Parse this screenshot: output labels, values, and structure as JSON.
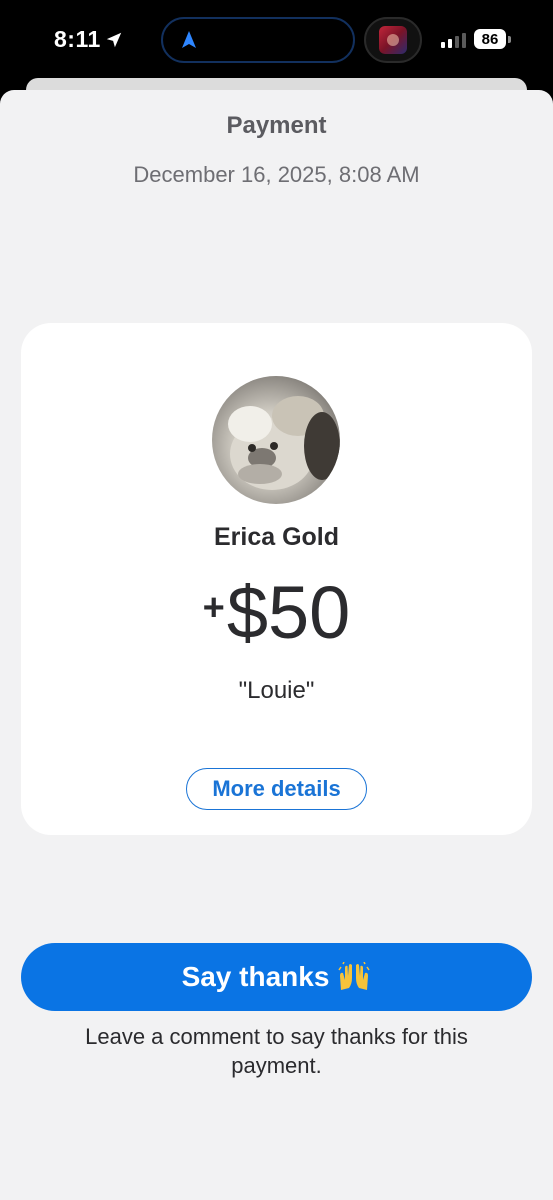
{
  "status_bar": {
    "time": "8:11",
    "battery": "86"
  },
  "header": {
    "title": "Payment",
    "date": "December 16, 2025, 8:08 AM"
  },
  "payment_card": {
    "name": "Erica Gold",
    "amount_sign": "+",
    "amount": "$50",
    "note": "\"Louie\"",
    "details_button": "More details"
  },
  "footer": {
    "thanks_button": "Say thanks",
    "thanks_emoji_icon": "raising-hands-icon",
    "helper_text": "Leave a comment to say thanks for this payment."
  },
  "colors": {
    "accent": "#0a74e4",
    "sheet_background": "#f2f2f3",
    "card_background": "#ffffff"
  }
}
